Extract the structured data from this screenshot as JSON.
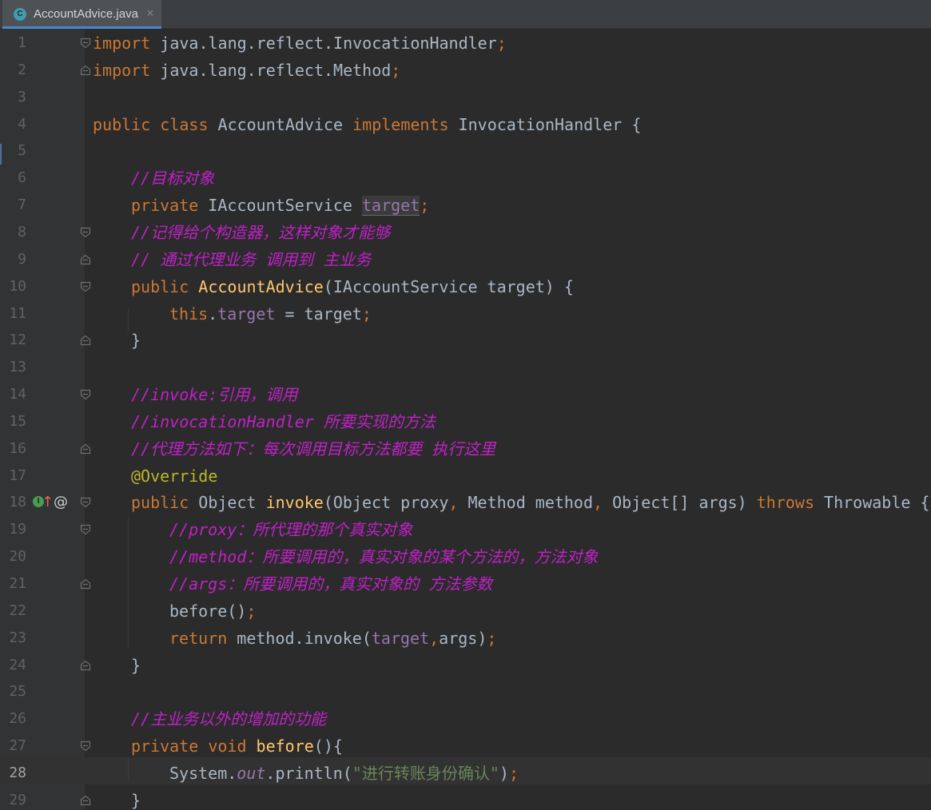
{
  "tab": {
    "filename": "AccountAdvice.java",
    "type_icon": "class-icon",
    "icon_letter": "C",
    "close": "×"
  },
  "gutter": {
    "implements_icon": "implement-method-icon",
    "implements_letter": "I",
    "override_icon": "override-arrow-icon",
    "override_glyph": "↑",
    "annotation_icon": "annotation-icon",
    "annotation_glyph": "@"
  },
  "editor": {
    "current_line": 28,
    "lines": [
      {
        "n": "1",
        "fold": "start",
        "indent": 0,
        "tokens": [
          {
            "c": "k",
            "t": "import"
          },
          {
            "c": "t",
            "t": " java.lang.reflect.InvocationHandler"
          },
          {
            "c": "k",
            "t": ";"
          }
        ]
      },
      {
        "n": "2",
        "fold": "end",
        "indent": 0,
        "tokens": [
          {
            "c": "k",
            "t": "import"
          },
          {
            "c": "t",
            "t": " java.lang.reflect.Method"
          },
          {
            "c": "k",
            "t": ";"
          }
        ]
      },
      {
        "n": "3",
        "indent": 0,
        "tokens": []
      },
      {
        "n": "4",
        "indent": 0,
        "tokens": [
          {
            "c": "k",
            "t": "public class "
          },
          {
            "c": "t",
            "t": "AccountAdvice "
          },
          {
            "c": "k",
            "t": "implements "
          },
          {
            "c": "t",
            "t": "InvocationHandler {"
          }
        ]
      },
      {
        "n": "5",
        "indent": 0,
        "tokens": []
      },
      {
        "n": "6",
        "indent": 1,
        "tokens": [
          {
            "c": "c",
            "t": "//目标对象"
          }
        ]
      },
      {
        "n": "7",
        "indent": 1,
        "tokens": [
          {
            "c": "k",
            "t": "private "
          },
          {
            "c": "t",
            "t": "IAccountService "
          },
          {
            "c": "f hl",
            "t": "target"
          },
          {
            "c": "k",
            "t": ";"
          }
        ]
      },
      {
        "n": "8",
        "fold": "start",
        "indent": 1,
        "tokens": [
          {
            "c": "c",
            "t": "//记得给个构造器，这样对象才能够"
          }
        ]
      },
      {
        "n": "9",
        "fold": "end",
        "indent": 1,
        "tokens": [
          {
            "c": "c",
            "t": "// 通过代理业务 调用到 主业务"
          }
        ]
      },
      {
        "n": "10",
        "fold": "start",
        "indent": 1,
        "tokens": [
          {
            "c": "k",
            "t": "public "
          },
          {
            "c": "m",
            "t": "AccountAdvice"
          },
          {
            "c": "t",
            "t": "(IAccountService target) {"
          }
        ]
      },
      {
        "n": "11",
        "indent": 2,
        "tokens": [
          {
            "c": "k",
            "t": "this"
          },
          {
            "c": "t",
            "t": "."
          },
          {
            "c": "f",
            "t": "target"
          },
          {
            "c": "t",
            "t": " = target"
          },
          {
            "c": "k",
            "t": ";"
          }
        ]
      },
      {
        "n": "12",
        "fold": "end",
        "indent": 1,
        "tokens": [
          {
            "c": "t",
            "t": "}"
          }
        ]
      },
      {
        "n": "13",
        "indent": 0,
        "tokens": []
      },
      {
        "n": "14",
        "fold": "start",
        "indent": 1,
        "tokens": [
          {
            "c": "c",
            "t": "//invoke:引用，调用"
          }
        ]
      },
      {
        "n": "15",
        "indent": 1,
        "tokens": [
          {
            "c": "c",
            "t": "//invocationHandler 所要实现的方法"
          }
        ]
      },
      {
        "n": "16",
        "fold": "end",
        "indent": 1,
        "tokens": [
          {
            "c": "c",
            "t": "//代理方法如下：每次调用目标方法都要 执行这里"
          }
        ]
      },
      {
        "n": "17",
        "indent": 1,
        "tokens": [
          {
            "c": "an",
            "t": "@Override"
          }
        ]
      },
      {
        "n": "18",
        "fold": "start",
        "marks": true,
        "indent": 1,
        "tokens": [
          {
            "c": "k",
            "t": "public "
          },
          {
            "c": "t",
            "t": "Object "
          },
          {
            "c": "m",
            "t": "invoke"
          },
          {
            "c": "t",
            "t": "(Object proxy"
          },
          {
            "c": "k",
            "t": ", "
          },
          {
            "c": "t",
            "t": "Method method"
          },
          {
            "c": "k",
            "t": ", "
          },
          {
            "c": "t",
            "t": "Object[] args) "
          },
          {
            "c": "k",
            "t": "throws "
          },
          {
            "c": "t",
            "t": "Throwable {"
          }
        ]
      },
      {
        "n": "19",
        "fold": "start",
        "indent": 2,
        "tokens": [
          {
            "c": "c",
            "t": "//proxy：所代理的那个真实对象"
          }
        ]
      },
      {
        "n": "20",
        "indent": 2,
        "tokens": [
          {
            "c": "c",
            "t": "//method：所要调用的，真实对象的某个方法的，方法对象"
          }
        ]
      },
      {
        "n": "21",
        "fold": "end",
        "indent": 2,
        "tokens": [
          {
            "c": "c",
            "t": "//args：所要调用的，真实对象的 方法参数"
          }
        ]
      },
      {
        "n": "22",
        "indent": 2,
        "tokens": [
          {
            "c": "t",
            "t": "before()"
          },
          {
            "c": "k",
            "t": ";"
          }
        ]
      },
      {
        "n": "23",
        "indent": 2,
        "tokens": [
          {
            "c": "k",
            "t": "return "
          },
          {
            "c": "t",
            "t": "method.invoke("
          },
          {
            "c": "f",
            "t": "target"
          },
          {
            "c": "k",
            "t": ","
          },
          {
            "c": "t",
            "t": "args)"
          },
          {
            "c": "k",
            "t": ";"
          }
        ]
      },
      {
        "n": "24",
        "fold": "end",
        "indent": 1,
        "tokens": [
          {
            "c": "t",
            "t": "}"
          }
        ]
      },
      {
        "n": "25",
        "indent": 0,
        "tokens": []
      },
      {
        "n": "26",
        "indent": 1,
        "tokens": [
          {
            "c": "c",
            "t": "//主业务以外的增加的功能"
          }
        ]
      },
      {
        "n": "27",
        "fold": "start",
        "indent": 1,
        "tokens": [
          {
            "c": "k",
            "t": "private void "
          },
          {
            "c": "m",
            "t": "before"
          },
          {
            "c": "t",
            "t": "(){"
          }
        ]
      },
      {
        "n": "28",
        "indent": 2,
        "tokens": [
          {
            "c": "t",
            "t": "System."
          },
          {
            "c": "fi",
            "t": "out"
          },
          {
            "c": "t",
            "t": ".println("
          },
          {
            "c": "s",
            "t": "\"进行转账身份确认\""
          },
          {
            "c": "t",
            "t": ")"
          },
          {
            "c": "k",
            "t": ";"
          }
        ]
      },
      {
        "n": "29",
        "fold": "end",
        "indent": 1,
        "tokens": [
          {
            "c": "t",
            "t": "}"
          }
        ]
      }
    ]
  }
}
